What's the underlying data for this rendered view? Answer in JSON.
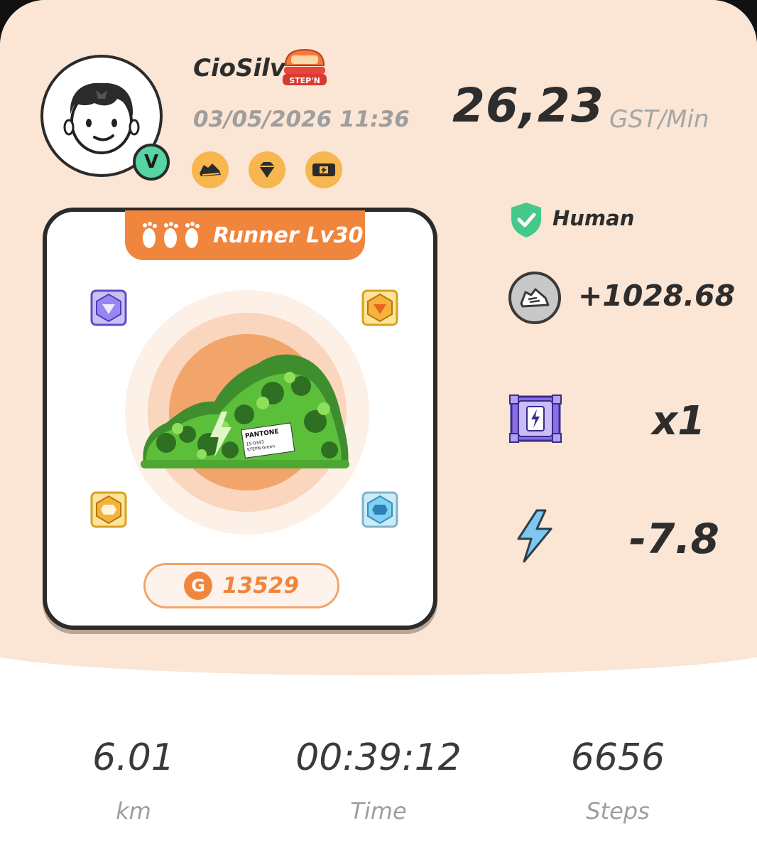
{
  "profile": {
    "username": "CioSilv",
    "datetime": "03/05/2026 11:36",
    "verified_badge": "V",
    "logo_text": "STEP'N",
    "perks": [
      "sneaker-icon",
      "gem-icon",
      "mystery-box-icon"
    ]
  },
  "earning_rate": {
    "value": "26,23",
    "unit": "GST/Min"
  },
  "sneaker": {
    "level_label": "Runner Lv30",
    "shoe_tag": "PANTONE",
    "shoe_tag_line2": "15-0343",
    "shoe_tag_line3": "STEPN Green",
    "mint_icon": "G",
    "mint_value": "13529",
    "gem_slots": [
      "purple-gem",
      "yellow-gem",
      "orange-gem",
      "cyan-gem"
    ]
  },
  "stats": {
    "human_label": "Human",
    "earned": "+1028.68",
    "mystery_box_count": "x1",
    "energy": "-7.8"
  },
  "summary": [
    {
      "value": "6.01",
      "label": "km"
    },
    {
      "value": "00:39:12",
      "label": "Time"
    },
    {
      "value": "6656",
      "label": "Steps"
    }
  ],
  "colors": {
    "background": "#fbe5d4",
    "accent_orange": "#f0863d",
    "verified_green": "#56d5a2",
    "shoe_green": "#5cbf3a",
    "energy_blue": "#7ec8f0",
    "box_purple": "#8a6ee6"
  }
}
